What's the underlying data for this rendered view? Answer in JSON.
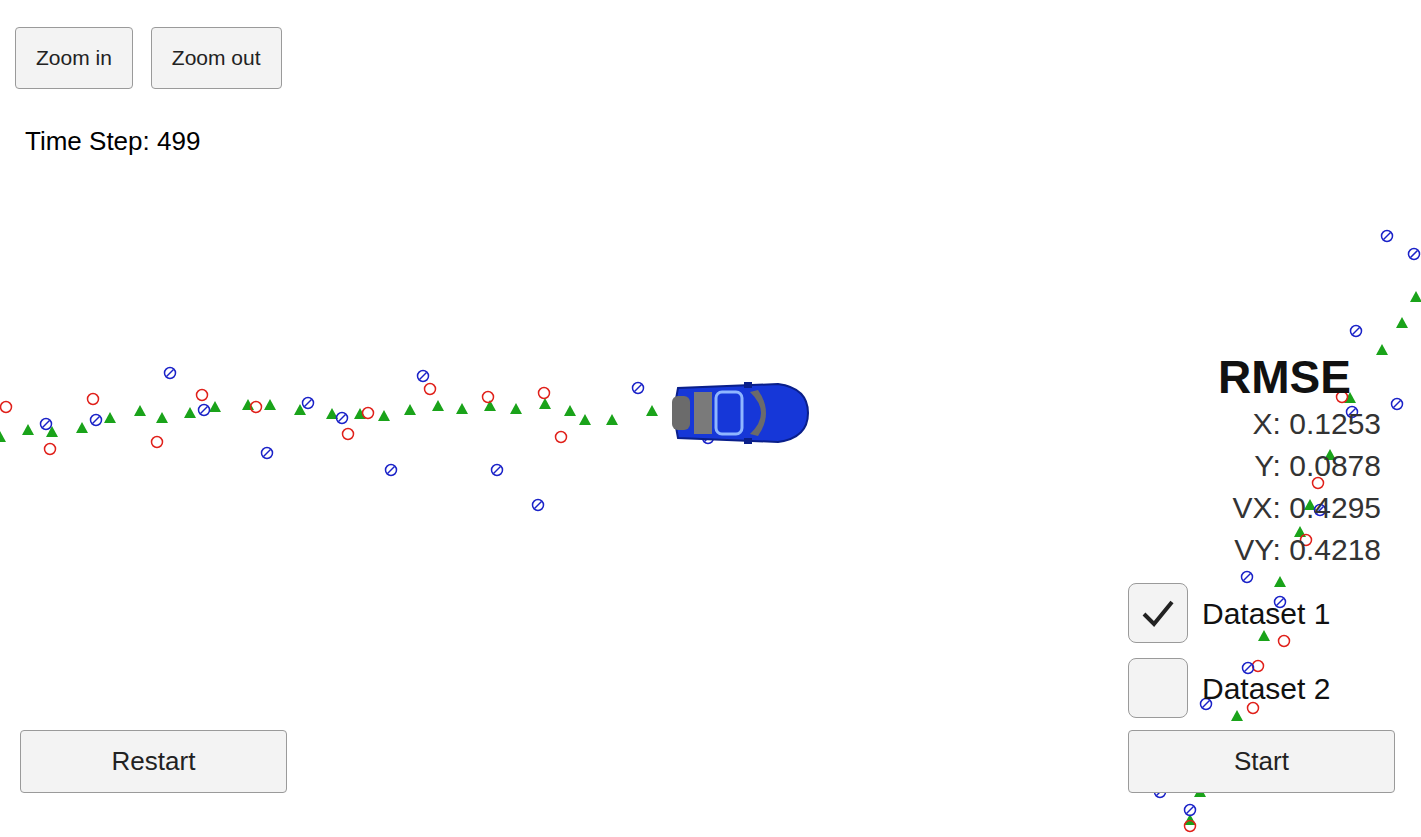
{
  "toolbar": {
    "buttons": [
      {
        "label": "Zoom in"
      },
      {
        "label": "Zoom out"
      }
    ]
  },
  "time_step": "Time Step: 499",
  "rmse": {
    "title": "RMSE",
    "rows": [
      "X: 0.1253",
      "Y: 0.0878",
      "VX: 0.4295",
      "VY: 0.4218"
    ]
  },
  "datasets": [
    {
      "label": "Dataset 1",
      "checked": true
    },
    {
      "label": "Dataset 2",
      "checked": false
    }
  ],
  "buttons": {
    "restart": "Restart",
    "start": "Start"
  },
  "scene": {
    "estimates": [
      [
        0,
        437
      ],
      [
        28,
        430
      ],
      [
        52,
        432
      ],
      [
        82,
        428
      ],
      [
        110,
        418
      ],
      [
        140,
        411
      ],
      [
        162,
        418
      ],
      [
        190,
        413
      ],
      [
        215,
        407
      ],
      [
        248,
        405
      ],
      [
        270,
        405
      ],
      [
        300,
        410
      ],
      [
        332,
        414
      ],
      [
        360,
        414
      ],
      [
        384,
        416
      ],
      [
        410,
        410
      ],
      [
        438,
        406
      ],
      [
        462,
        409
      ],
      [
        490,
        406
      ],
      [
        516,
        409
      ],
      [
        545,
        404
      ],
      [
        570,
        411
      ],
      [
        585,
        420
      ],
      [
        612,
        420
      ],
      [
        652,
        411
      ],
      [
        1190,
        820
      ],
      [
        1200,
        792
      ],
      [
        1237,
        716
      ],
      [
        1264,
        636
      ],
      [
        1280,
        582
      ],
      [
        1300,
        532
      ],
      [
        1310,
        505
      ],
      [
        1330,
        455
      ],
      [
        1350,
        398
      ],
      [
        1382,
        350
      ],
      [
        1402,
        323
      ],
      [
        1416,
        297
      ]
    ],
    "lidar": [
      [
        6,
        407
      ],
      [
        50,
        449
      ],
      [
        93,
        399
      ],
      [
        157,
        442
      ],
      [
        202,
        395
      ],
      [
        256,
        407
      ],
      [
        348,
        434
      ],
      [
        368,
        413
      ],
      [
        430,
        389
      ],
      [
        488,
        397
      ],
      [
        544,
        393
      ],
      [
        561,
        437
      ],
      [
        1190,
        826
      ],
      [
        1253,
        708
      ],
      [
        1258,
        666
      ],
      [
        1284,
        641
      ],
      [
        1306,
        540
      ],
      [
        1318,
        483
      ],
      [
        1342,
        397
      ]
    ],
    "radar": [
      [
        46,
        424
      ],
      [
        96,
        420
      ],
      [
        170,
        373
      ],
      [
        204,
        410
      ],
      [
        267,
        453
      ],
      [
        308,
        403
      ],
      [
        342,
        418
      ],
      [
        391,
        470
      ],
      [
        423,
        376
      ],
      [
        497,
        470
      ],
      [
        538,
        505
      ],
      [
        638,
        388
      ],
      [
        708,
        438
      ],
      [
        1190,
        810
      ],
      [
        1160,
        792
      ],
      [
        1206,
        704
      ],
      [
        1248,
        668
      ],
      [
        1247,
        577
      ],
      [
        1280,
        602
      ],
      [
        1320,
        510
      ],
      [
        1352,
        412
      ],
      [
        1356,
        331
      ],
      [
        1387,
        236
      ],
      [
        1397,
        404
      ],
      [
        1414,
        254
      ]
    ]
  }
}
